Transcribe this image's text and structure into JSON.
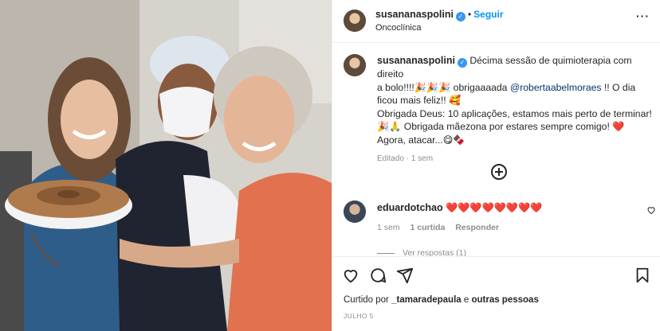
{
  "post": {
    "username": "susananaspolini",
    "follow_label": "Seguir",
    "location": "Oncoclínica",
    "caption_line1": "Décima sessão de quimioterapia com direito",
    "caption_line2a": "a bolo!!!!🎉🎉🎉 obrigaaaada ",
    "caption_mention": "@robertaabelmoraes",
    "caption_line2b": " !! O dia",
    "caption_line3": "ficou mais feliz!! 🥰",
    "caption_line4": "Obrigada Deus: 10 aplicações, estamos mais perto de terminar!",
    "caption_line5": "🎉🙏 Obrigada mãezona por estares sempre comigo! ❤️",
    "caption_line6": "Agora, atacar...😋🍫",
    "edited_label": "Editado",
    "edited_time": "1 sem"
  },
  "comment": {
    "username": "eduardotchao",
    "text": "❤️❤️❤️❤️❤️❤️❤️❤️",
    "time": "1 sem",
    "likes": "1 curtida",
    "reply_label": "Responder",
    "view_replies": "Ver respostas (1)"
  },
  "footer": {
    "liked_prefix": "Curtido por ",
    "liked_user": "_tamaradepaula",
    "liked_suffix": " e ",
    "liked_others": "outras pessoas",
    "date": "JULHO 5"
  },
  "icons": {
    "like": "heart-icon",
    "comment": "comment-icon",
    "share": "share-icon",
    "save": "bookmark-icon",
    "more": "more-options-icon",
    "add_comment": "add-comment-icon"
  },
  "colors": {
    "link_blue": "#0095f6",
    "mention": "#00376b",
    "muted": "#8e8e8e",
    "verified": "#3897f0"
  }
}
